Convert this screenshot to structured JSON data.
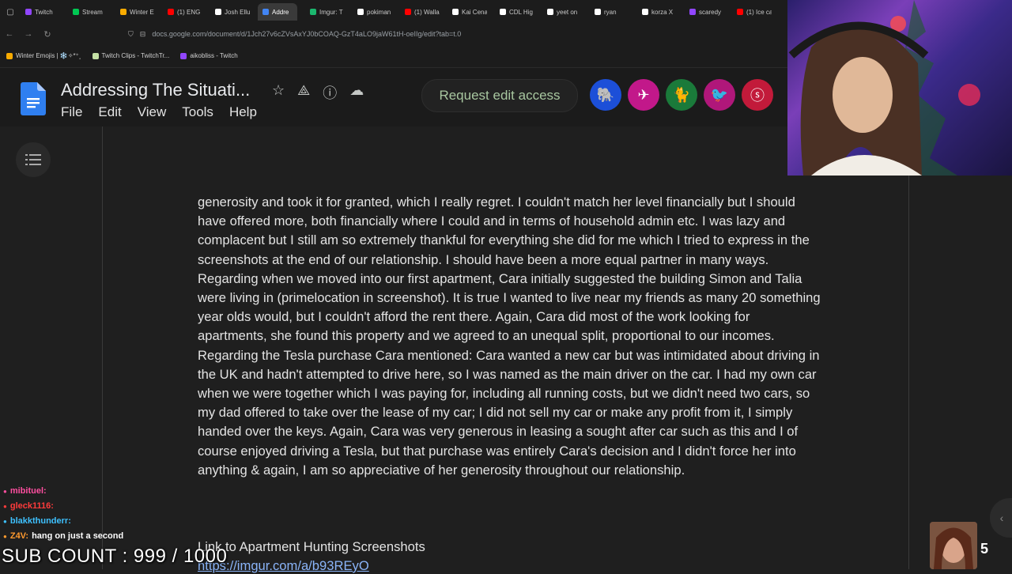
{
  "browser": {
    "tabs": [
      {
        "label": "Twitch",
        "color": "#9146ff",
        "active": false
      },
      {
        "label": "Stream",
        "color": "#00c853",
        "active": false
      },
      {
        "label": "Winter E",
        "color": "#f9ab00",
        "active": false
      },
      {
        "label": "(1) ENG",
        "color": "#ff0000",
        "active": false
      },
      {
        "label": "Josh Ellu",
        "color": "#ffffff",
        "active": false
      },
      {
        "label": "Addre",
        "color": "#4285f4",
        "active": true
      },
      {
        "label": "Imgur: T",
        "color": "#1bb76e",
        "active": false
      },
      {
        "label": "pokiman",
        "color": "#ffffff",
        "active": false
      },
      {
        "label": "(1) Walla",
        "color": "#ff0000",
        "active": false
      },
      {
        "label": "Kai Cena",
        "color": "#ffffff",
        "active": false
      },
      {
        "label": "CDL Hig",
        "color": "#ffffff",
        "active": false
      },
      {
        "label": "yeet on",
        "color": "#ffffff",
        "active": false
      },
      {
        "label": "ryan",
        "color": "#ffffff",
        "active": false
      },
      {
        "label": "korza X",
        "color": "#ffffff",
        "active": false
      },
      {
        "label": "scaredy",
        "color": "#9146ff",
        "active": false
      },
      {
        "label": "(1) Ice ca",
        "color": "#ff0000",
        "active": false
      }
    ],
    "url": "docs.google.com/document/d/1Jch27v6cZVsAxYJ0bCOAQ-GzT4aLO9jaW61tH-oeIIg/edit?tab=t.0",
    "bookmarks": [
      {
        "label": "Winter Emojis | ❄️✧*⁺˳",
        "color": "#f9ab00"
      },
      {
        "label": "Twitch Clips - TwitchTr...",
        "color": "#c5e1a5"
      },
      {
        "label": "aikobliss - Twitch",
        "color": "#9146ff"
      }
    ]
  },
  "docs": {
    "title": "Addressing The Situati...",
    "menu": [
      "File",
      "Edit",
      "View",
      "Tools",
      "Help"
    ],
    "request_button": "Request edit access",
    "body": "generosity and took it for granted, which I really regret. I couldn't match her level financially but I should have offered more, both financially where I could and in terms of household admin etc. I was lazy and complacent but I still am so extremely thankful for everything she did for me which I tried to express in the screenshots at the end of our relationship. I should have been a more equal partner in many ways. Regarding when we moved into our first apartment, Cara initially suggested the building Simon and Talia were living in (primelocation in screenshot). It is true I wanted to live near my friends as many 20 something year olds would, but I couldn't afford the rent there. Again, Cara did most of the work looking for apartments, she found this property and we agreed to an unequal split, proportional to our incomes. Regarding the Tesla purchase Cara mentioned: Cara wanted a new car but was intimidated about driving in the UK and hadn't attempted to drive here, so I was named as the main driver on the car. I had my own car when we were together which I was paying for, including all running costs, but we didn't need two cars, so my dad offered to take over the lease of my car; I did not sell my car or make any profit from it, I simply handed over the keys. Again, Cara was very generous in leasing a sought after car such as this and I of course enjoyed driving a Tesla, but that purchase was entirely Cara's decision and I didn't force her into anything & again, I am so appreciative of her generosity throughout our relationship.",
    "link_heading": "Link to Apartment Hunting Screenshots",
    "link_url": "https://imgur.com/a/b93REyO"
  },
  "overlay": {
    "chat": [
      {
        "user": "mibituel:",
        "message": "",
        "color": "#ff4fa0"
      },
      {
        "user": "gleck1116:",
        "message": "",
        "color": "#ff3b3b"
      },
      {
        "user": "blakkthunderr:",
        "message": "",
        "color": "#3ec1ff"
      },
      {
        "user": "Z4V:",
        "message": "hang on just a second",
        "color": "#ff9a2e"
      }
    ],
    "sub_count": "SUB COUNT : 999 / 1000",
    "viewer_badge": "5"
  }
}
